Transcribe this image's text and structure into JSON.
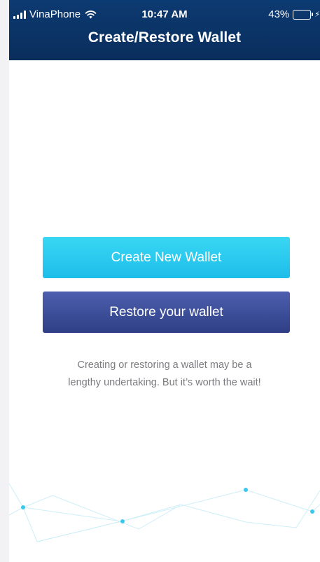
{
  "status_bar": {
    "carrier": "VinaPhone",
    "time": "10:47 AM",
    "battery_percent": "43%",
    "battery_level": 0.43,
    "icons": [
      "signal-icon",
      "wifi-icon",
      "battery-icon",
      "charging-bolt-icon"
    ]
  },
  "header": {
    "title": "Create/Restore Wallet"
  },
  "actions": {
    "create_label": "Create New Wallet",
    "restore_label": "Restore your wallet"
  },
  "note": {
    "line1": "Creating or restoring a wallet may be a",
    "line2": "lengthy undertaking. But it’s worth the wait!"
  },
  "colors": {
    "header_bg": "#0c3a72",
    "create_button": "#2ccbef",
    "restore_button": "#3a4c97",
    "note_text": "#7b7b80",
    "decor_line": "#cdeff7",
    "decor_dot": "#3cc8ee"
  }
}
